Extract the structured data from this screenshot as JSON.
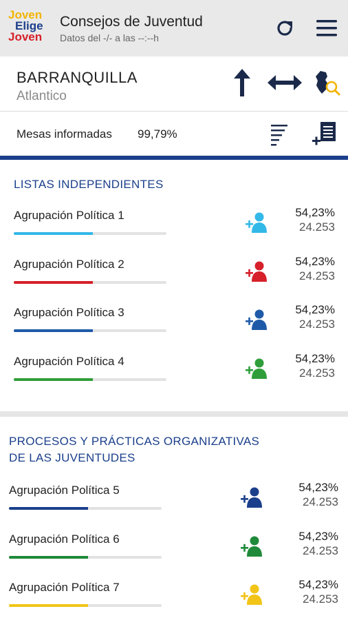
{
  "header": {
    "logo": {
      "line1": "Joven",
      "line2": "Elige",
      "line3": "Joven"
    },
    "title": "Consejos de Juventud",
    "subtitle": "Datos del -/- a las --:--h"
  },
  "location": {
    "city": "BARRANQUILLA",
    "department": "Atlantico"
  },
  "mesas": {
    "label": "Mesas informadas",
    "value": "99,79%"
  },
  "colors": {
    "primary": "#1b3f8b",
    "cyan": "#33b8e8",
    "red": "#d6202a",
    "blue": "#1f5aa8",
    "green": "#2f9e3a",
    "navy": "#1b3f8b",
    "darkgreen": "#1f8a3a",
    "yellow": "#f2c417"
  },
  "sections": [
    {
      "title": "LISTAS INDEPENDIENTES",
      "rows": [
        {
          "name": "Agrupación Política 1",
          "percent": "54,23%",
          "votes": "24.253",
          "color": "#33b8e8",
          "icon": "add-person-icon",
          "progress": 0.52
        },
        {
          "name": "Agrupación Política 2",
          "percent": "54,23%",
          "votes": "24.253",
          "color": "#d6202a",
          "icon": "add-person-icon",
          "progress": 0.52
        },
        {
          "name": "Agrupación Política 3",
          "percent": "54,23%",
          "votes": "24.253",
          "color": "#1f5aa8",
          "icon": "add-person-icon",
          "progress": 0.52
        },
        {
          "name": "Agrupación Política 4",
          "percent": "54,23%",
          "votes": "24.253",
          "color": "#2f9e3a",
          "icon": "add-person-icon",
          "progress": 0.52
        }
      ]
    },
    {
      "title_line1": "PROCESOS Y PRÁCTICAS ORGANIZATIVAS",
      "title_line2": "DE LAS JUVENTUDES",
      "rows": [
        {
          "name": "Agrupación Política 5",
          "percent": "54,23%",
          "votes": "24.253",
          "color": "#1b3f8b",
          "icon": "add-person-icon",
          "progress": 0.52
        },
        {
          "name": "Agrupación Política 6",
          "percent": "54,23%",
          "votes": "24.253",
          "color": "#1f8a3a",
          "icon": "add-person-icon",
          "progress": 0.52
        },
        {
          "name": "Agrupación Política 7",
          "percent": "54,23%",
          "votes": "24.253",
          "color": "#f2c417",
          "icon": "add-person-icon",
          "progress": 0.52
        }
      ]
    }
  ]
}
